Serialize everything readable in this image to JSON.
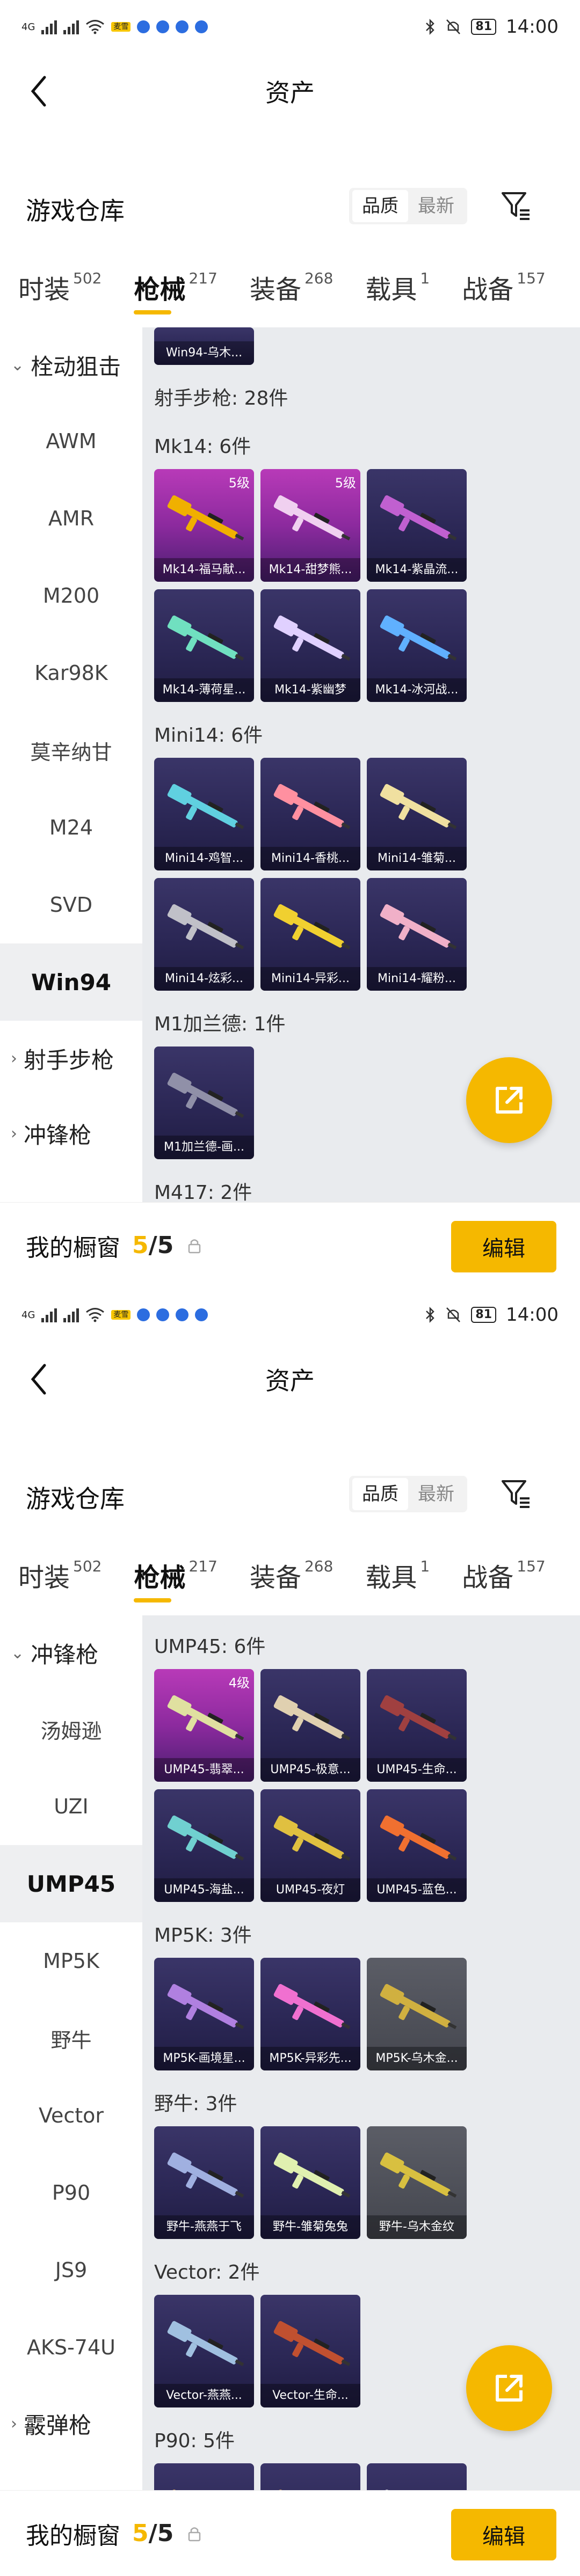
{
  "colors": {
    "accent": "#f5b800",
    "content_bg": "#e9ebee",
    "card_purple": "#2b2755",
    "card_pink": "#8c2a9e"
  },
  "status": {
    "network": "4G",
    "time": "14:00",
    "battery": "81",
    "badge": "麦雪"
  },
  "header": {
    "title": "资产",
    "back_icon": "chevron-left-icon"
  },
  "warehouse": {
    "title": "游戏仓库",
    "sort_quality": "品质",
    "sort_latest": "最新"
  },
  "tabs": [
    {
      "label": "时装",
      "count": "502"
    },
    {
      "label": "枪械",
      "count": "217"
    },
    {
      "label": "装备",
      "count": "268"
    },
    {
      "label": "载具",
      "count": "1"
    },
    {
      "label": "战备",
      "count": "157"
    }
  ],
  "bottom": {
    "showcase_label": "我的橱窗",
    "current": "5",
    "total": "5",
    "edit": "编辑"
  },
  "screen1": {
    "nav_top": {
      "label": "栓动狙击"
    },
    "nav_items": [
      "AWM",
      "AMR",
      "M200",
      "Kar98K",
      "莫辛纳甘",
      "M24",
      "SVD",
      "Win94"
    ],
    "nav_bottom": [
      {
        "label": "射手步枪"
      },
      {
        "label": "冲锋枪"
      }
    ],
    "top_partial": "Win94-乌木...",
    "groups": [
      {
        "label": "射手步枪: 28件",
        "cards": []
      },
      {
        "label": "Mk14: 6件",
        "cards": [
          {
            "name": "Mk14-福马献...",
            "level": "5级",
            "q": "pink",
            "color": "#f0b000"
          },
          {
            "name": "Mk14-甜梦熊...",
            "level": "5级",
            "q": "pink",
            "color": "#f0d0f0"
          },
          {
            "name": "Mk14-紫晶流...",
            "level": "",
            "q": "purple",
            "color": "#c060d0"
          },
          {
            "name": "Mk14-薄荷星...",
            "level": "",
            "q": "purple",
            "color": "#70e0c0"
          },
          {
            "name": "Mk14-紫幽梦",
            "level": "",
            "q": "purple",
            "color": "#e0d0ff"
          },
          {
            "name": "Mk14-冰河战...",
            "level": "",
            "q": "purple",
            "color": "#60b0ff"
          }
        ]
      },
      {
        "label": "Mini14: 6件",
        "cards": [
          {
            "name": "Mini14-鸡智...",
            "level": "",
            "q": "purple",
            "color": "#60d0e0"
          },
          {
            "name": "Mini14-香桃...",
            "level": "",
            "q": "purple",
            "color": "#ff90a0"
          },
          {
            "name": "Mini14-雏菊...",
            "level": "",
            "q": "purple",
            "color": "#f0e0a0"
          },
          {
            "name": "Mini14-炫彩...",
            "level": "",
            "q": "purple",
            "color": "#c0c0c8"
          },
          {
            "name": "Mini14-异彩...",
            "level": "",
            "q": "purple",
            "color": "#f0d030"
          },
          {
            "name": "Mini14-耀粉...",
            "level": "",
            "q": "purple",
            "color": "#f0b0c8"
          }
        ]
      },
      {
        "label": "M1加兰德: 1件",
        "cards": [
          {
            "name": "M1加兰德-画...",
            "level": "",
            "q": "purple",
            "color": "#9090a8"
          }
        ]
      },
      {
        "label": "M417: 2件",
        "cards": []
      }
    ]
  },
  "screen2": {
    "nav_top": {
      "label": "冲锋枪"
    },
    "nav_items": [
      "汤姆逊",
      "UZI",
      "UMP45",
      "MP5K",
      "野牛",
      "Vector",
      "P90",
      "JS9",
      "AKS-74U"
    ],
    "nav_bottom": [
      {
        "label": "霰弹枪"
      }
    ],
    "groups": [
      {
        "label": "UMP45: 6件",
        "cards": [
          {
            "name": "UMP45-翡翠...",
            "level": "4级",
            "q": "pink",
            "color": "#e0e0a0"
          },
          {
            "name": "UMP45-极意...",
            "level": "",
            "q": "purple",
            "color": "#e0d0b0"
          },
          {
            "name": "UMP45-生命...",
            "level": "",
            "q": "purple",
            "color": "#a04040"
          },
          {
            "name": "UMP45-海盐...",
            "level": "",
            "q": "purple",
            "color": "#70d0d0"
          },
          {
            "name": "UMP45-夜灯",
            "level": "",
            "q": "purple",
            "color": "#e0c040"
          },
          {
            "name": "UMP45-蓝色...",
            "level": "",
            "q": "purple",
            "color": "#f07030"
          }
        ]
      },
      {
        "label": "MP5K: 3件",
        "cards": [
          {
            "name": "MP5K-画境星...",
            "level": "",
            "q": "purple",
            "color": "#b080e0"
          },
          {
            "name": "MP5K-异彩先...",
            "level": "",
            "q": "purple",
            "color": "#f070d0"
          },
          {
            "name": "MP5K-乌木金...",
            "level": "",
            "q": "gray",
            "color": "#d0b040"
          }
        ]
      },
      {
        "label": "野牛: 3件",
        "cards": [
          {
            "name": "野牛-燕燕于飞",
            "level": "",
            "q": "purple",
            "color": "#a0b0e0"
          },
          {
            "name": "野牛-雏菊兔兔",
            "level": "",
            "q": "purple",
            "color": "#e0f0b0"
          },
          {
            "name": "野牛-乌木金纹",
            "level": "",
            "q": "gray",
            "color": "#d8c040"
          }
        ]
      },
      {
        "label": "Vector: 2件",
        "cards": [
          {
            "name": "Vector-燕燕...",
            "level": "",
            "q": "purple",
            "color": "#a0c0e0"
          },
          {
            "name": "Vector-生命...",
            "level": "",
            "q": "purple",
            "color": "#c05030"
          }
        ]
      },
      {
        "label": "P90: 5件",
        "cards": [
          {
            "name": "",
            "level": "",
            "q": "purple",
            "color": "#d0a060"
          },
          {
            "name": "",
            "level": "",
            "q": "purple",
            "color": "#c09060"
          },
          {
            "name": "",
            "level": "",
            "q": "purple",
            "color": "#c0c0d0"
          },
          {
            "name": "",
            "level": "",
            "q": "purple",
            "color": "#e0c030"
          }
        ]
      }
    ]
  }
}
